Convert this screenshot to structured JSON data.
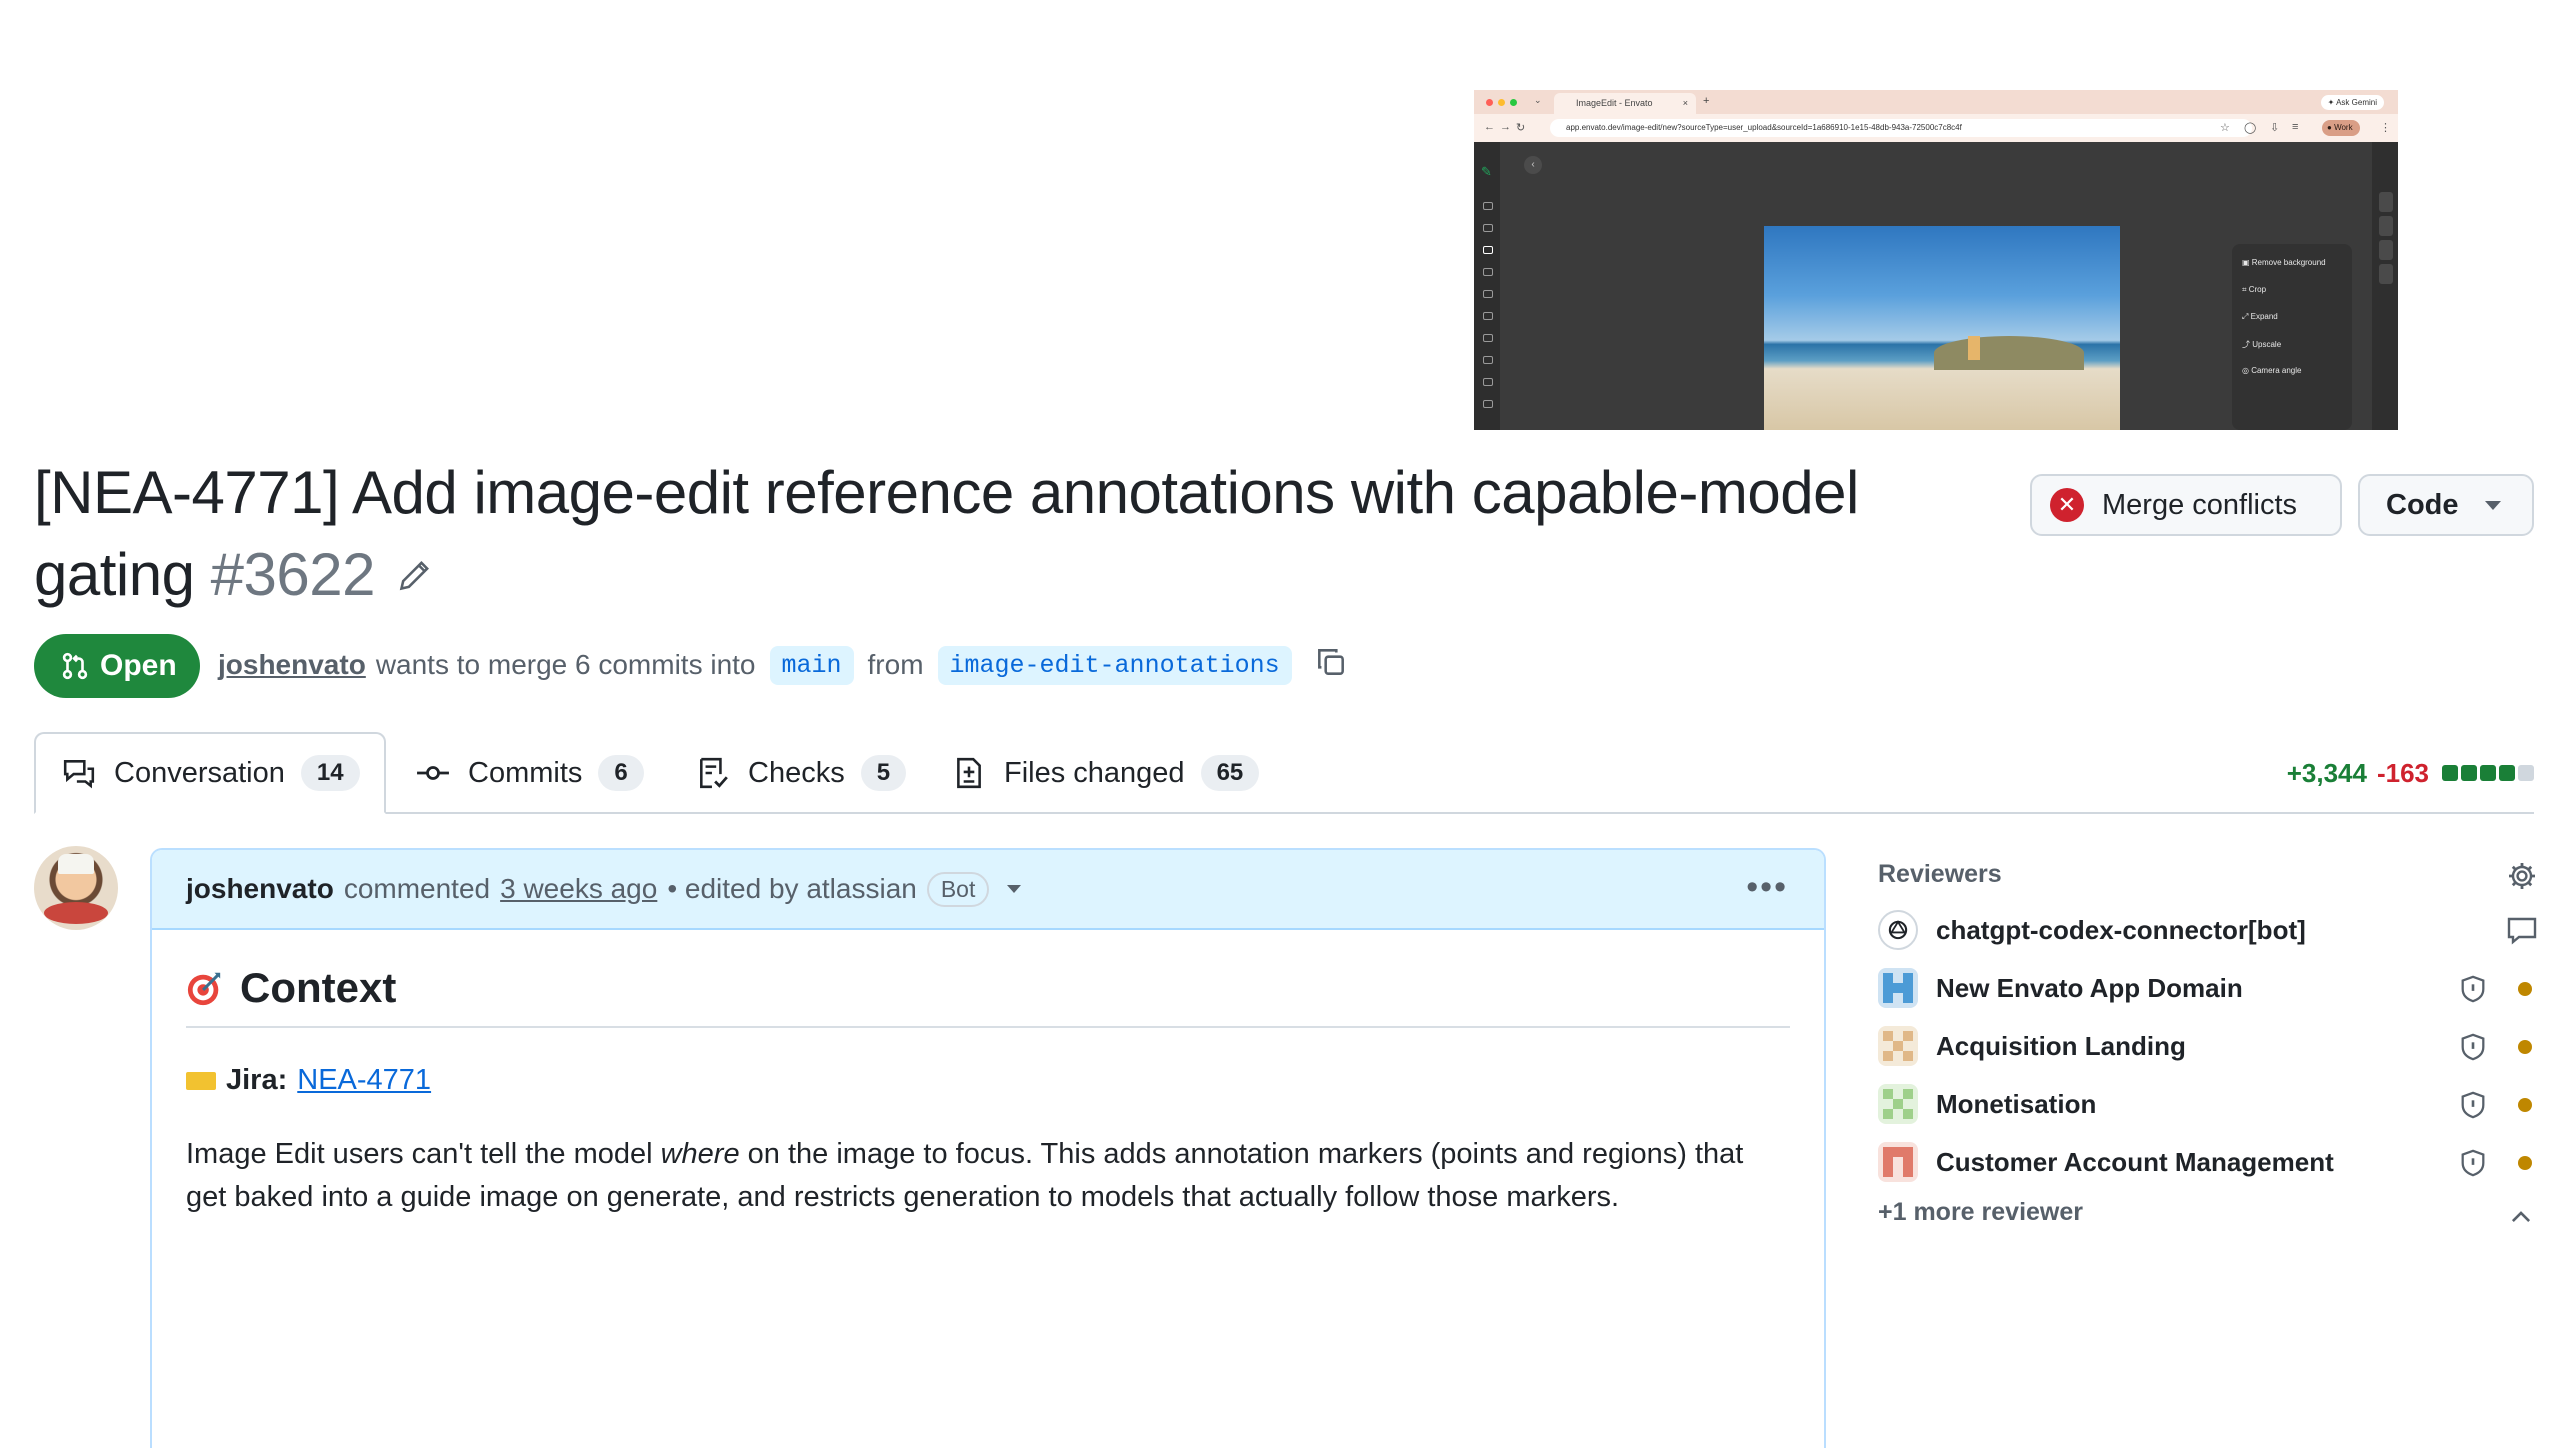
{
  "screenshot": {
    "tab_title": "ImageEdit - Envato",
    "ask_gemini": "Ask Gemini",
    "url": "app.envato.dev/image-edit/new?sourceType=user_upload&sourceId=1a686910-1e15-48db-943a-72500c7c8c4f",
    "profile_label": "Work",
    "menu_items": [
      "Remove background",
      "Crop",
      "Expand",
      "Upscale",
      "Camera angle"
    ]
  },
  "pr": {
    "title": "[NEA-4771] Add image-edit reference annotations with capable-model gating",
    "number": "#3622",
    "state": "Open",
    "author": "joshenvato",
    "merge_text": "wants to merge 6 commits into",
    "base_branch": "main",
    "from_text": "from",
    "head_branch": "image-edit-annotations"
  },
  "buttons": {
    "merge_conflicts": "Merge conflicts",
    "code": "Code"
  },
  "tabs": [
    {
      "label": "Conversation",
      "count": "14"
    },
    {
      "label": "Commits",
      "count": "6"
    },
    {
      "label": "Checks",
      "count": "5"
    },
    {
      "label": "Files changed",
      "count": "65"
    }
  ],
  "diffstat": {
    "additions": "+3,344",
    "deletions": "-163",
    "colors": {
      "add": "#1a7f37",
      "del": "#cf222e",
      "neutral": "#d0d7de"
    }
  },
  "comment": {
    "author": "joshenvato",
    "action": "commented",
    "time": "3 weeks ago",
    "edited": "• edited by atlassian",
    "bot_badge": "Bot",
    "heading": "Context",
    "jira_label": "Jira:",
    "jira_link": "NEA-4771",
    "desc_1": "Image Edit users can't tell the model ",
    "desc_em": "where",
    "desc_2": " on the image to focus. This adds annotation markers (points and regions) that get baked into a guide image on generate, and restricts generation to models that actually follow those markers."
  },
  "reviewers": {
    "title": "Reviewers",
    "items": [
      {
        "name": "chatgpt-codex-connector[bot]",
        "status_icon": "comment-icon"
      },
      {
        "name": "New Envato App Domain",
        "status_icon": "shield-icon",
        "pending_color": "#bf8700"
      },
      {
        "name": "Acquisition Landing",
        "status_icon": "shield-icon",
        "pending_color": "#bf8700"
      },
      {
        "name": "Monetisation",
        "status_icon": "shield-icon",
        "pending_color": "#bf8700"
      },
      {
        "name": "Customer Account Management",
        "status_icon": "shield-icon",
        "pending_color": "#bf8700"
      }
    ],
    "more": "+1 more reviewer"
  }
}
